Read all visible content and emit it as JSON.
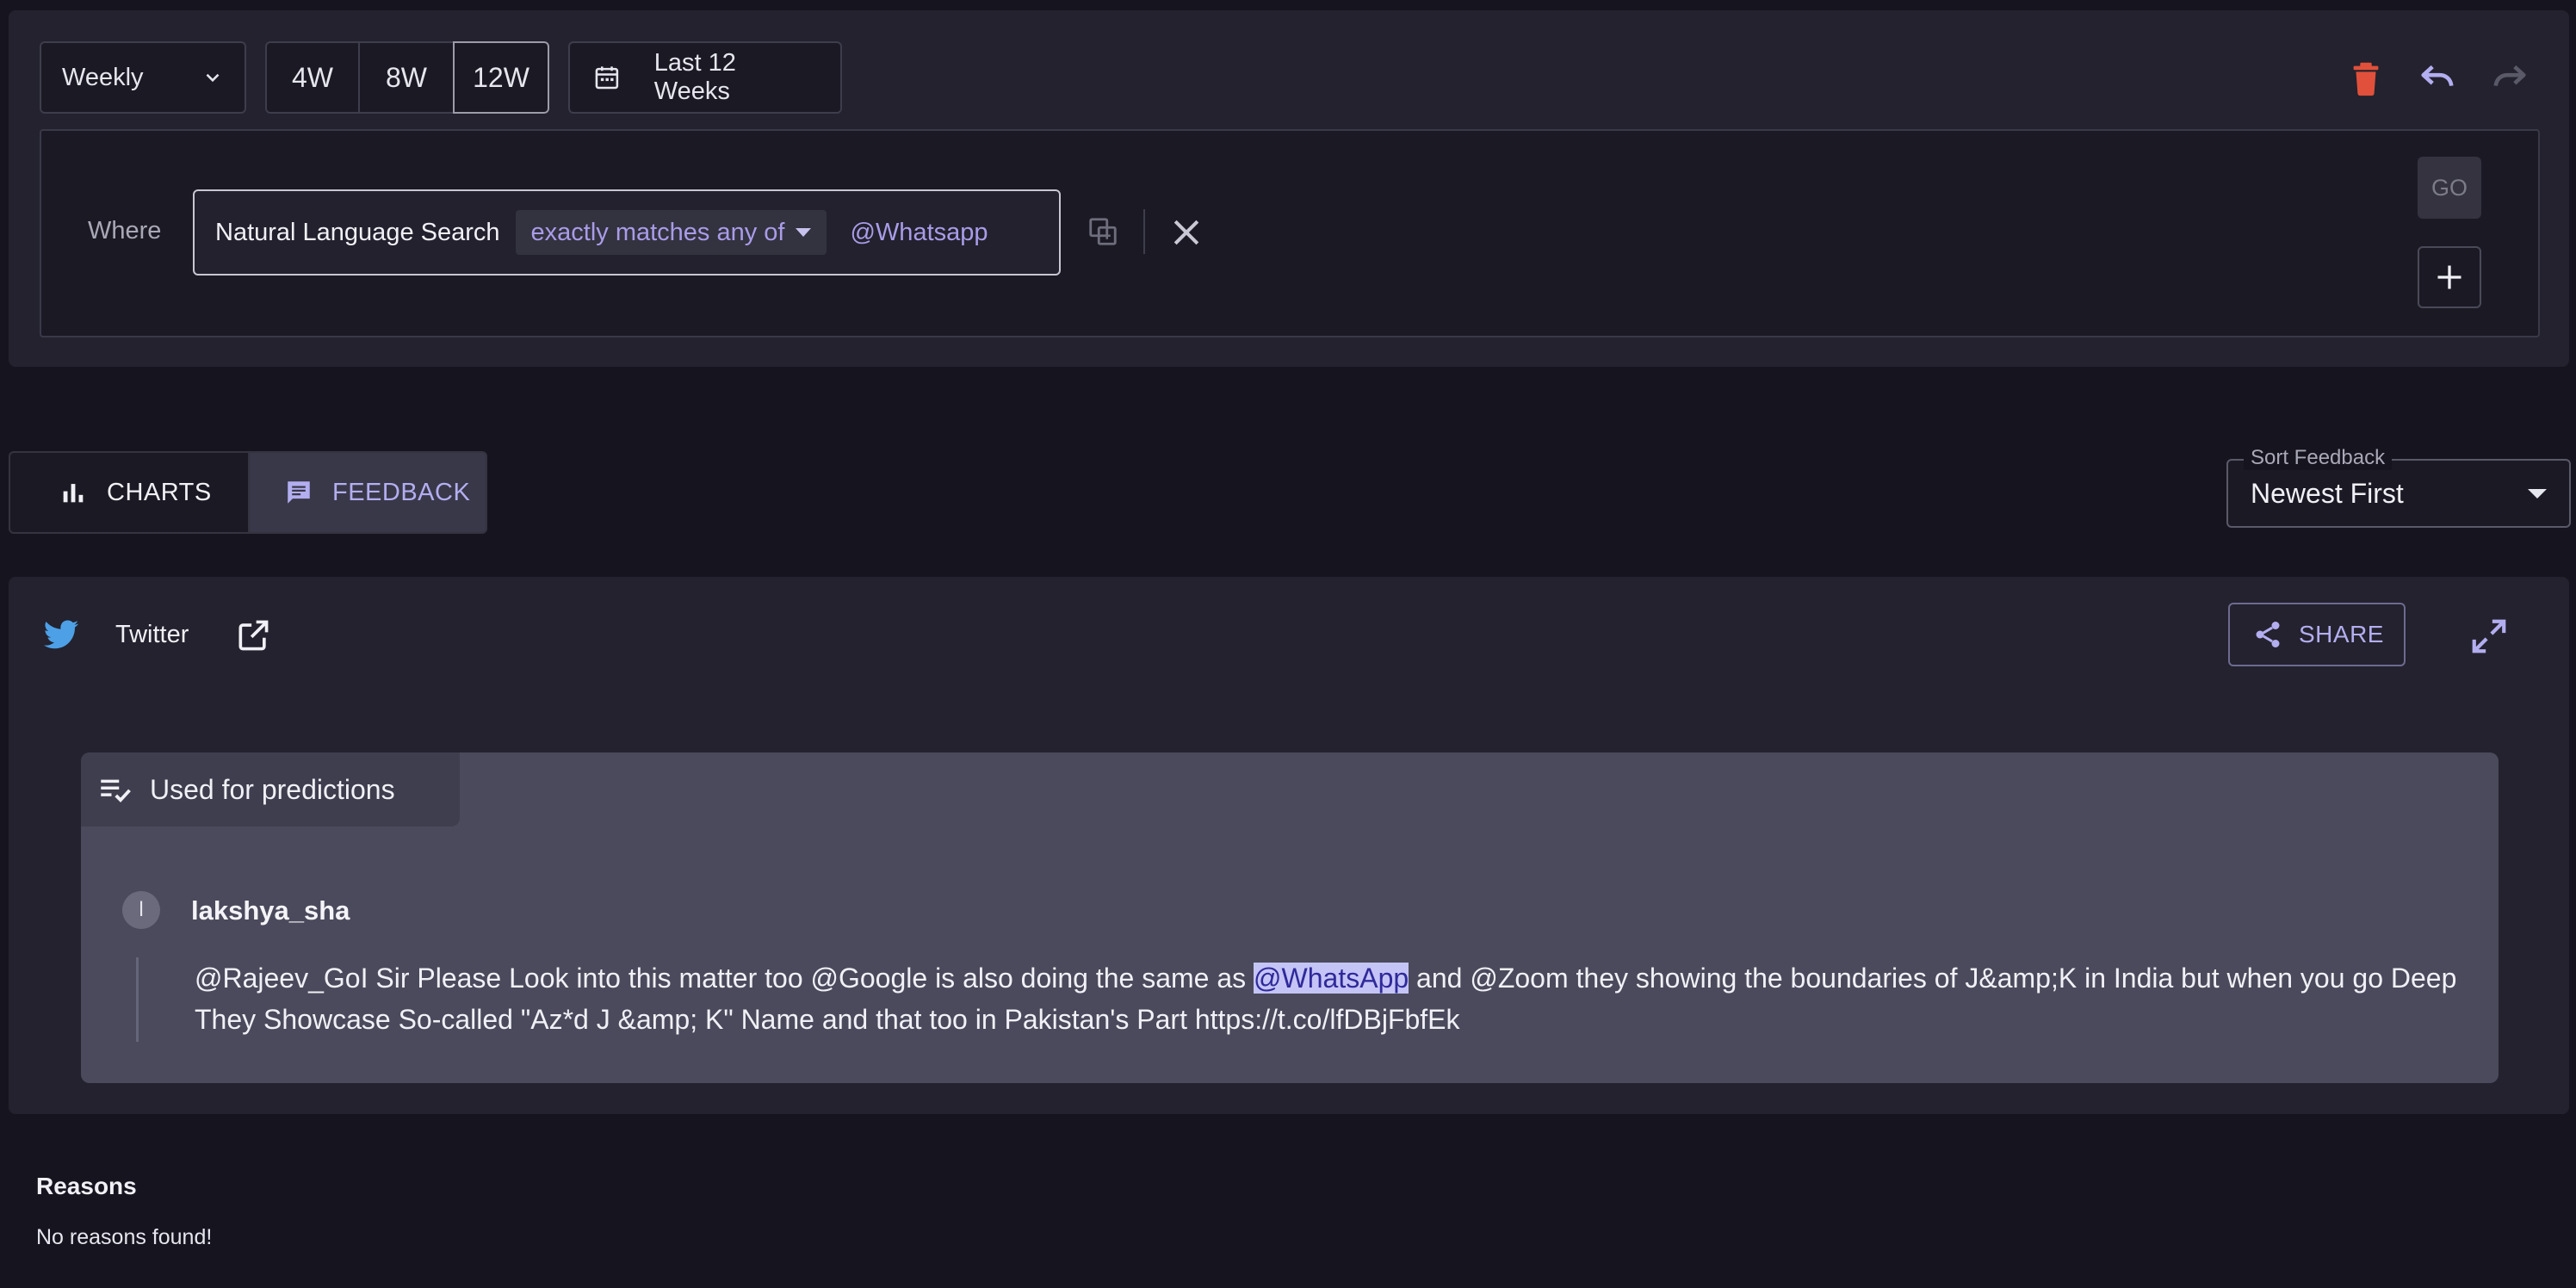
{
  "filters": {
    "granularity": {
      "selected": "Weekly"
    },
    "ranges": [
      {
        "label": "4W",
        "active": false
      },
      {
        "label": "8W",
        "active": false
      },
      {
        "label": "12W",
        "active": true
      }
    ],
    "date_range": {
      "label": "Last 12 Weeks"
    },
    "toolbar": {
      "delete_icon": "trash-icon",
      "undo_icon": "undo-icon",
      "redo_icon": "redo-icon"
    },
    "where_label": "Where",
    "condition": {
      "field": "Natural Language Search",
      "operator": "exactly matches any of",
      "value": "@Whatsapp"
    },
    "go_label": "GO"
  },
  "view_tabs": {
    "charts_label": "CHARTS",
    "feedback_label": "FEEDBACK",
    "active": "feedback"
  },
  "sort": {
    "legend": "Sort Feedback",
    "selected": "Newest First"
  },
  "feedback": {
    "source": "Twitter",
    "share_label": "SHARE",
    "prediction_badge": "Used for predictions",
    "author": {
      "avatar_initial": "l",
      "name": "lakshya_sha"
    },
    "message": {
      "before": "@Rajeev_GoI Sir Please Look into this matter too @Google is also doing the same as ",
      "highlight": "@WhatsApp",
      "after": " and @Zoom they showing the boundaries of J&amp;K in India but when you go Deep They Showcase So-called \"Az*d J &amp; K\" Name and that too in Pakistan's Part https://t.co/lfDBjFbfEk"
    }
  },
  "reasons": {
    "title": "Reasons",
    "empty_text": "No reasons found!"
  },
  "colors": {
    "accent": "#b3aef0",
    "delete": "#e0503a",
    "twitter": "#4da0e6",
    "highlight_bg": "#c5c4f6"
  }
}
